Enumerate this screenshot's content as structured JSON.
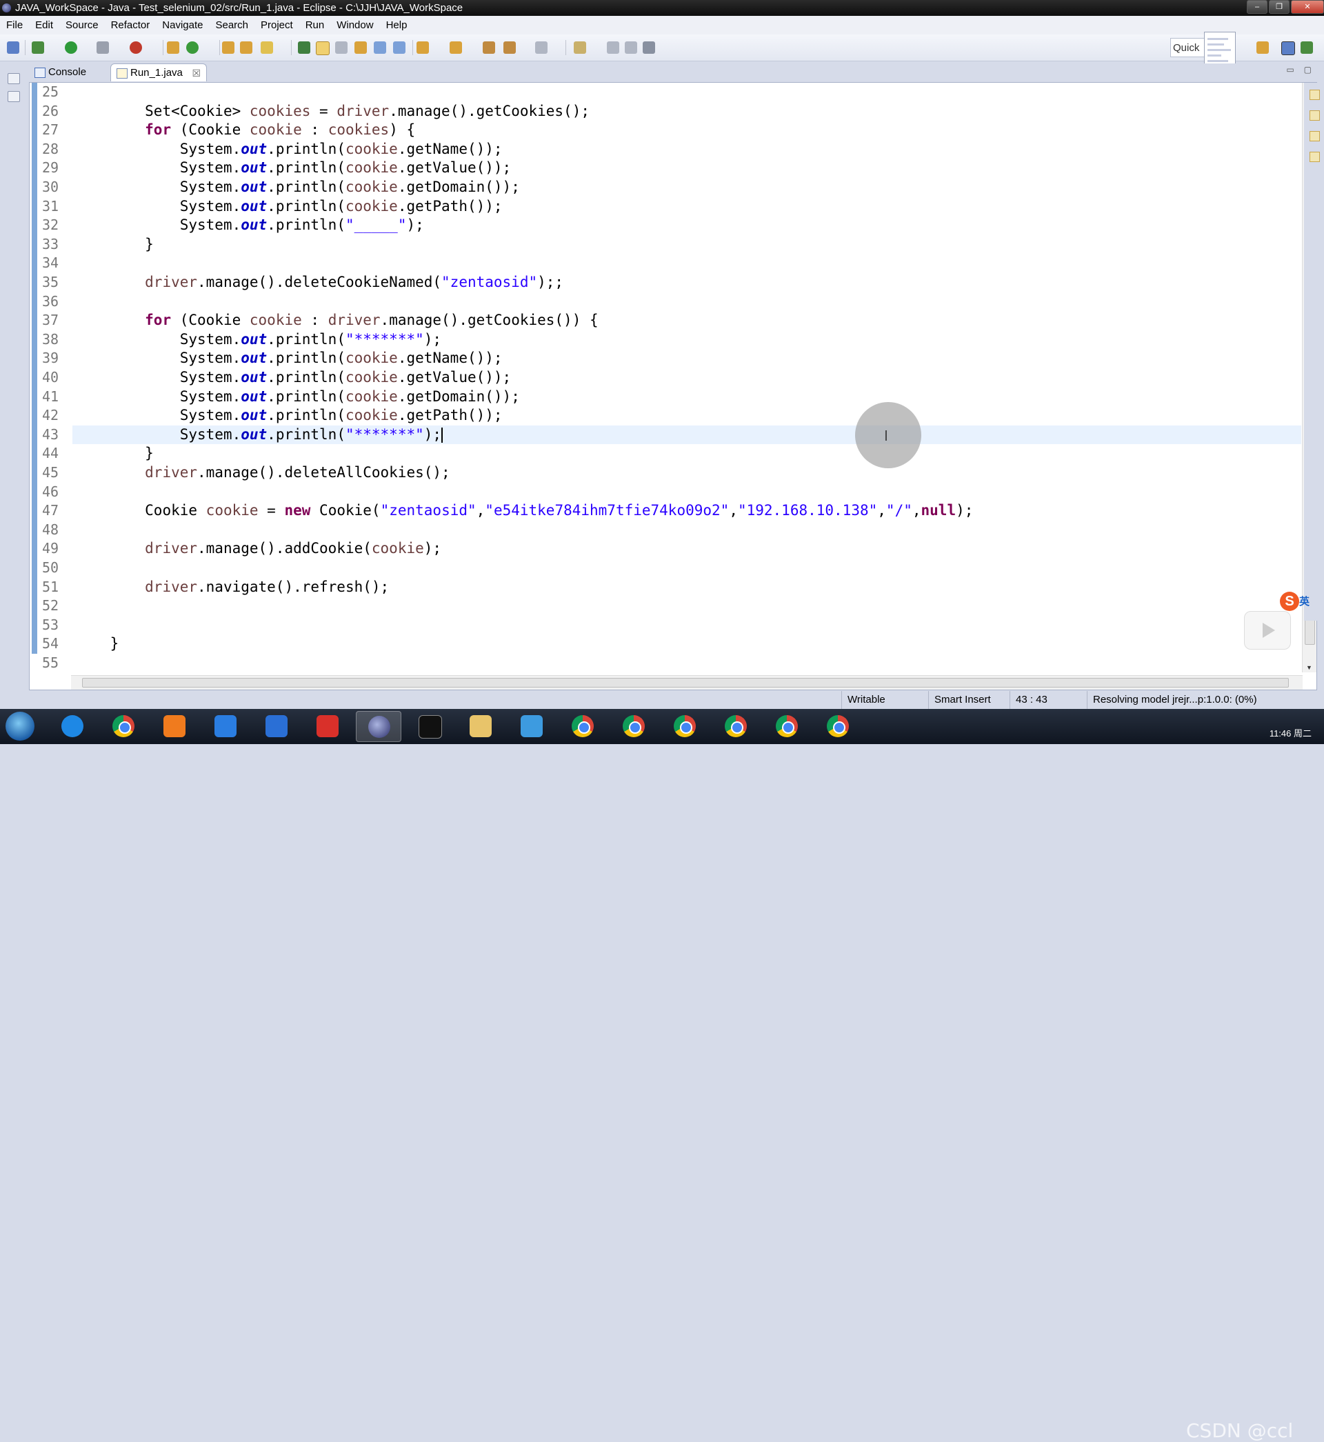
{
  "window": {
    "title": "JAVA_WorkSpace - Java - Test_selenium_02/src/Run_1.java - Eclipse - C:\\JJH\\JAVA_WorkSpace",
    "minimize": "‒",
    "maximize": "❐",
    "close": "✕"
  },
  "menu": [
    "File",
    "Edit",
    "Source",
    "Refactor",
    "Navigate",
    "Search",
    "Project",
    "Run",
    "Window",
    "Help"
  ],
  "toolbar": {
    "quick_access": "Quick"
  },
  "tabs": {
    "console": "Console",
    "editor": "Run_1.java",
    "close": "☒"
  },
  "view_controls": {
    "minimize": "▭",
    "maximize": "▢"
  },
  "editor": {
    "lines": [
      {
        "n": "25"
      },
      {
        "n": "26"
      },
      {
        "n": "27"
      },
      {
        "n": "28"
      },
      {
        "n": "29"
      },
      {
        "n": "30"
      },
      {
        "n": "31"
      },
      {
        "n": "32"
      },
      {
        "n": "33"
      },
      {
        "n": "34"
      },
      {
        "n": "35"
      },
      {
        "n": "36"
      },
      {
        "n": "37"
      },
      {
        "n": "38"
      },
      {
        "n": "39"
      },
      {
        "n": "40"
      },
      {
        "n": "41"
      },
      {
        "n": "42"
      },
      {
        "n": "43"
      },
      {
        "n": "44"
      },
      {
        "n": "45"
      },
      {
        "n": "46"
      },
      {
        "n": "47"
      },
      {
        "n": "48"
      },
      {
        "n": "49"
      },
      {
        "n": "50"
      },
      {
        "n": "51"
      },
      {
        "n": "52"
      },
      {
        "n": "53"
      },
      {
        "n": "54"
      },
      {
        "n": "55"
      }
    ],
    "code": {
      "l26": "Set<Cookie> cookies = driver.manage().getCookies();",
      "l27": "for (Cookie cookie : cookies) {",
      "l28": "System.out.println(cookie.getName());",
      "l29": "System.out.println(cookie.getValue());",
      "l30": "System.out.println(cookie.getDomain());",
      "l31": "System.out.println(cookie.getPath());",
      "l32": "System.out.println(\"_____\");",
      "l33": "}",
      "l35": "driver.manage().deleteCookieNamed(\"zentaosid\");;",
      "l37": "for (Cookie cookie : driver.manage().getCookies()) {",
      "l38": "System.out.println(\"*******\");",
      "l39": "System.out.println(cookie.getName());",
      "l40": "System.out.println(cookie.getValue());",
      "l41": "System.out.println(cookie.getDomain());",
      "l42": "System.out.println(cookie.getPath());",
      "l43": "System.out.println(\"*******\");",
      "l44": "}",
      "l45": "driver.manage().deleteAllCookies();",
      "l47": "Cookie cookie = new Cookie(\"zentaosid\",\"e54itke784ihm7tfie74ko09o2\",\"192.168.10.138\",\"/\",null);",
      "l49": "driver.manage().addCookie(cookie);",
      "l51": "driver.navigate().refresh();",
      "l54": "}"
    },
    "cursor_glyph": "I"
  },
  "statusbar": {
    "mode": "Writable",
    "insert": "Smart Insert",
    "position": "43 : 43",
    "progress": "Resolving model jrejr...p:1.0.0: (0%)"
  },
  "taskbar": {
    "clock_time": "11:46 周二",
    "watermark": "CSDN @ccl"
  },
  "ime": {
    "logo": "S",
    "lang": "英"
  },
  "colors": {
    "keyword": "#7f0055",
    "string": "#2a00ff",
    "field": "#0000c0",
    "variable": "#6a3e3e",
    "current_line": "#e8f2fe",
    "chrome_bg": "#d6dbe9"
  }
}
